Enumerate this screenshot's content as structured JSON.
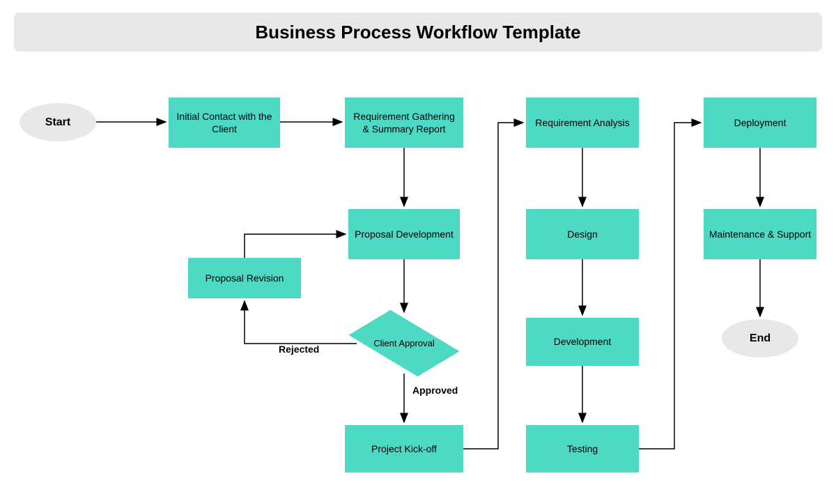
{
  "title": "Business Process Workflow Template",
  "nodes": {
    "start": "Start",
    "initial_contact": "Initial Contact with the Client",
    "requirement_gathering": "Requirement Gathering & Summary Report",
    "proposal_development": "Proposal Development",
    "proposal_revision": "Proposal Revision",
    "client_approval": "Client Approval",
    "project_kickoff": "Project Kick-off",
    "requirement_analysis": "Requirement Analysis",
    "design": "Design",
    "development": "Development",
    "testing": "Testing",
    "deployment": "Deployment",
    "maintenance": "Maintenance & Support",
    "end": "End"
  },
  "edge_labels": {
    "rejected": "Rejected",
    "approved": "Approved"
  },
  "colors": {
    "process_fill": "#4ED9C4",
    "terminator_fill": "#E8E8E8",
    "title_bg": "#E8E8E8"
  }
}
